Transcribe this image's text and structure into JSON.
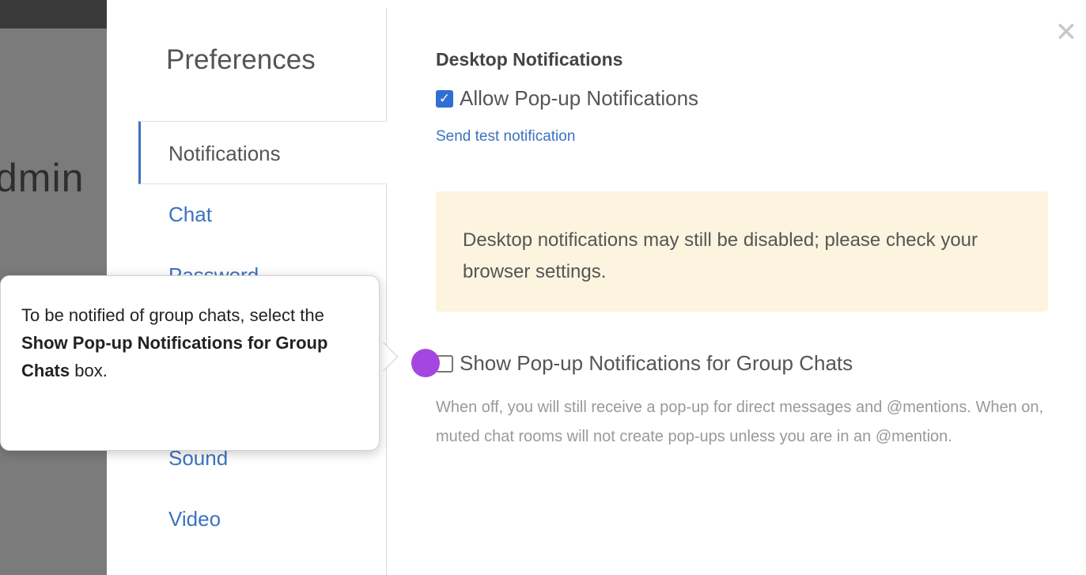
{
  "background": {
    "partial_text": "dmin"
  },
  "dialog": {
    "title": "Preferences",
    "close_icon": "close-icon",
    "nav": [
      {
        "label": "Notifications",
        "active": true
      },
      {
        "label": "Chat"
      },
      {
        "label": "Password"
      },
      {
        "label": ""
      },
      {
        "label": ""
      },
      {
        "label": "Sound"
      },
      {
        "label": "Video"
      }
    ]
  },
  "content": {
    "section_title": "Desktop Notifications",
    "allow_popups": {
      "label": "Allow Pop-up Notifications",
      "checked": true
    },
    "send_test_link": "Send test notification",
    "alert_text": "Desktop notifications may still be disabled; please check your browser settings.",
    "group_chats": {
      "label": "Show Pop-up Notifications for Group Chats",
      "checked": false
    },
    "group_help": "When off, you will still receive a pop-up for direct messages and @mentions. When on, muted chat rooms will not create pop-ups unless you are in an @mention."
  },
  "tooltip": {
    "text_before": "To be notified of group chats, select the ",
    "text_bold": "Show Pop-up Notifications for Group Chats",
    "text_after": " box."
  },
  "colors": {
    "accent": "#3b73c0",
    "hotspot": "#a447e0",
    "alert_bg": "#fcf4df"
  }
}
